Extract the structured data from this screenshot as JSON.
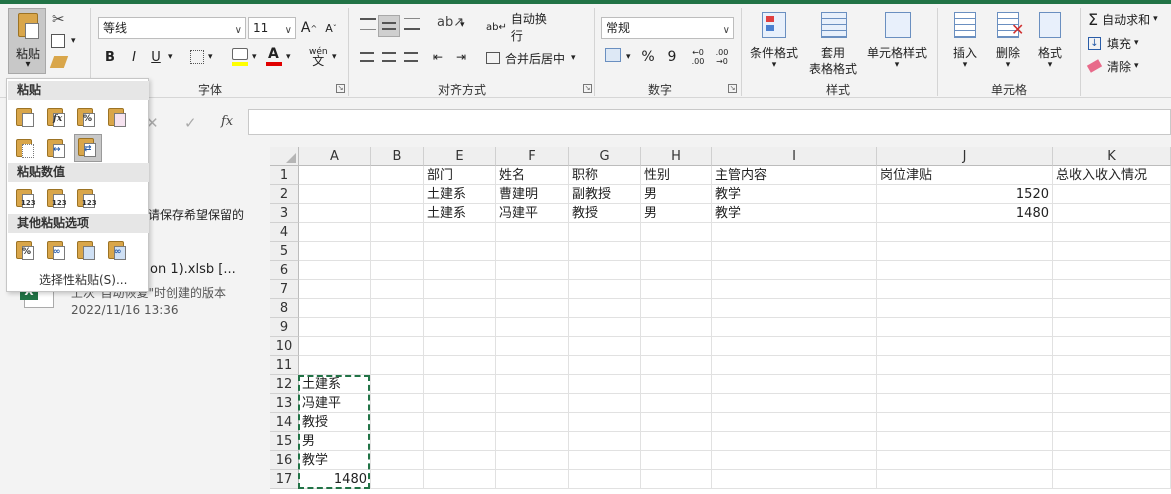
{
  "ribbon": {
    "clipboard": {
      "paste_label": "粘贴",
      "paste_caret": "▾"
    },
    "font": {
      "group_label": "字体",
      "font_name": "等线",
      "font_size": "11",
      "grow_label": "A",
      "shrink_label": "A",
      "bold": "B",
      "italic": "I",
      "underline": "U",
      "wen_label": "wén"
    },
    "alignment": {
      "group_label": "对齐方式",
      "wrap_text": "自动换行",
      "merge_center": "合并后居中"
    },
    "number": {
      "group_label": "数字",
      "format": "常规",
      "percent": "%",
      "comma": "9",
      "inc_dec": "←0 .00",
      "dec_dec": ".00 →0"
    },
    "styles": {
      "group_label": "样式",
      "conditional": "条件格式",
      "table_format_1": "套用",
      "table_format_2": "表格格式",
      "cell_styles": "单元格样式"
    },
    "cells": {
      "group_label": "单元格",
      "insert": "插入",
      "delete": "删除",
      "format": "格式"
    },
    "editing": {
      "autosum": "自动求和",
      "fill": "填充",
      "clear": "清除"
    }
  },
  "formula_bar": {
    "cancel": "✕",
    "enter": "✓",
    "fx": "fx",
    "value": ""
  },
  "paste_menu": {
    "section_paste": "粘贴",
    "section_values": "粘贴数值",
    "section_other": "其他粘贴选项",
    "paste_special": "选择性粘贴(S)...",
    "value_icon_text": "123",
    "formula_icon_text": "fx",
    "percent_icon_text": "%"
  },
  "recovery_panel": {
    "notice_fragment": "请保存希望保留的",
    "file_name": "on 1).xlsb  [...",
    "version_note": "上次\"自动恢复\"时创建的版本",
    "timestamp": "2022/11/16 13:36",
    "excel_icon_letter": "X"
  },
  "sheet": {
    "columns": [
      "A",
      "B",
      "E",
      "F",
      "G",
      "H",
      "I",
      "J",
      "K"
    ],
    "rows": [
      "1",
      "2",
      "3",
      "4",
      "5",
      "6",
      "7",
      "8",
      "9",
      "10",
      "11",
      "12",
      "13",
      "14",
      "15",
      "16",
      "17"
    ],
    "header_row": {
      "E": "部门",
      "F": "姓名",
      "G": "职称",
      "H": "性别",
      "I": "主管内容",
      "J": "岗位津贴",
      "K": "总收入收入情况"
    },
    "row2": {
      "E": "土建系",
      "F": "曹建明",
      "G": "副教授",
      "H": "男",
      "I": "教学",
      "J": "1520"
    },
    "row3": {
      "E": "土建系",
      "F": "冯建平",
      "G": "教授",
      "H": "男",
      "I": "教学",
      "J": "1480"
    },
    "colA": {
      "r12": "土建系",
      "r13": "冯建平",
      "r14": "教授",
      "r15": "男",
      "r16": "教学",
      "r17": "1480"
    }
  },
  "colors": {
    "accent": "#217346",
    "marquee": "#217346",
    "menu_section_bg": "#e6e6e6"
  }
}
